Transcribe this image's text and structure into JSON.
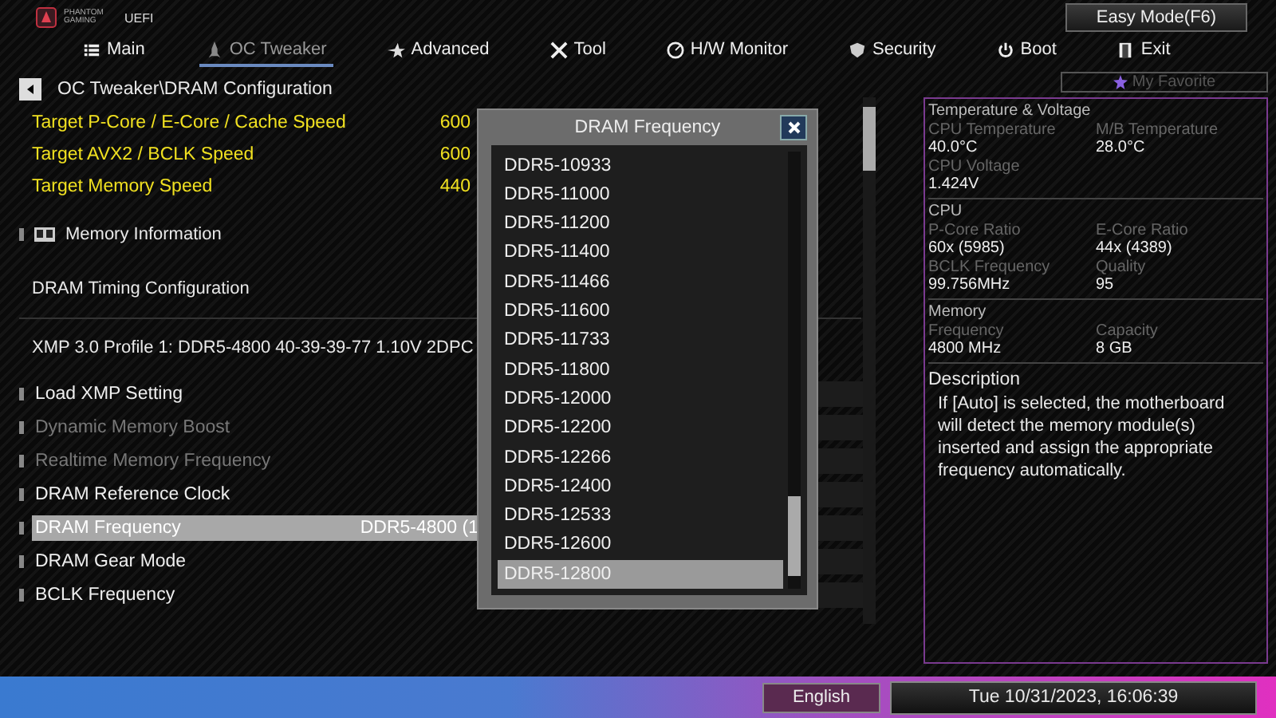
{
  "brand": {
    "logo_text": "PHANTOM GAMING",
    "uefi": "UEFI"
  },
  "easy_mode_button": "Easy Mode(F6)",
  "tabs": [
    {
      "label": "Main",
      "selected": false
    },
    {
      "label": "OC Tweaker",
      "selected": true
    },
    {
      "label": "Advanced",
      "selected": false
    },
    {
      "label": "Tool",
      "selected": false
    },
    {
      "label": "H/W Monitor",
      "selected": false
    },
    {
      "label": "Security",
      "selected": false
    },
    {
      "label": "Boot",
      "selected": false
    },
    {
      "label": "Exit",
      "selected": false
    }
  ],
  "my_favorite": "My Favorite",
  "breadcrumb": "OC Tweaker\\DRAM Configuration",
  "targets": [
    {
      "label": "Target P-Core / E-Core / Cache Speed",
      "value": "600"
    },
    {
      "label": "Target AVX2 / BCLK Speed",
      "value": "600"
    },
    {
      "label": "Target Memory Speed",
      "value": "440"
    }
  ],
  "items": [
    {
      "kind": "submenu",
      "label": "Memory Information"
    },
    {
      "kind": "heading",
      "label": "DRAM Timing Configuration"
    },
    {
      "kind": "info",
      "label": "XMP 3.0 Profile 1: DDR5-4800 40-39-39-77 1.10V 2DPC"
    },
    {
      "kind": "setting",
      "label": "Load XMP Setting",
      "disabled": false,
      "selected": false
    },
    {
      "kind": "setting",
      "label": "Dynamic Memory Boost",
      "disabled": true,
      "selected": false
    },
    {
      "kind": "setting",
      "label": "Realtime Memory Frequency",
      "disabled": true,
      "selected": false
    },
    {
      "kind": "setting",
      "label": "DRAM Reference Clock",
      "disabled": false,
      "selected": false
    },
    {
      "kind": "setting",
      "label": "DRAM Frequency",
      "value": "DDR5-4800 (1",
      "disabled": false,
      "selected": true
    },
    {
      "kind": "setting",
      "label": "DRAM Gear Mode",
      "disabled": false,
      "selected": false
    },
    {
      "kind": "setting",
      "label": "BCLK Frequency",
      "disabled": false,
      "selected": false
    }
  ],
  "dialog": {
    "title": "DRAM Frequency",
    "options": [
      {
        "label": "DDR5-10933",
        "selected": false
      },
      {
        "label": "DDR5-11000",
        "selected": false
      },
      {
        "label": "DDR5-11200",
        "selected": false
      },
      {
        "label": "DDR5-11400",
        "selected": false
      },
      {
        "label": "DDR5-11466",
        "selected": false
      },
      {
        "label": "DDR5-11600",
        "selected": false
      },
      {
        "label": "DDR5-11733",
        "selected": false
      },
      {
        "label": "DDR5-11800",
        "selected": false
      },
      {
        "label": "DDR5-12000",
        "selected": false
      },
      {
        "label": "DDR5-12200",
        "selected": false
      },
      {
        "label": "DDR5-12266",
        "selected": false
      },
      {
        "label": "DDR5-12400",
        "selected": false
      },
      {
        "label": "DDR5-12533",
        "selected": false
      },
      {
        "label": "DDR5-12600",
        "selected": false
      },
      {
        "label": "DDR5-12800",
        "selected": true
      }
    ]
  },
  "monitor": {
    "sections": [
      {
        "title": "Temperature & Voltage",
        "fields": [
          {
            "label": "CPU Temperature",
            "value": "40.0°C"
          },
          {
            "label": "M/B Temperature",
            "value": "28.0°C"
          },
          {
            "label": "CPU Voltage",
            "value": "1.424V"
          }
        ]
      },
      {
        "title": "CPU",
        "fields": [
          {
            "label": "P-Core Ratio",
            "value": "60x (5985)"
          },
          {
            "label": "E-Core Ratio",
            "value": "44x (4389)"
          },
          {
            "label": "BCLK Frequency",
            "value": "99.756MHz"
          },
          {
            "label": "Quality",
            "value": "95"
          }
        ]
      },
      {
        "title": "Memory",
        "fields": [
          {
            "label": "Frequency",
            "value": "4800 MHz"
          },
          {
            "label": "Capacity",
            "value": "8 GB"
          }
        ]
      }
    ],
    "description_title": "Description",
    "description": "If [Auto] is selected, the motherboard will detect the memory module(s) inserted and assign the appropriate frequency automatically."
  },
  "status_bar": {
    "language": "English",
    "datetime": "Tue 10/31/2023, 16:06:39"
  }
}
